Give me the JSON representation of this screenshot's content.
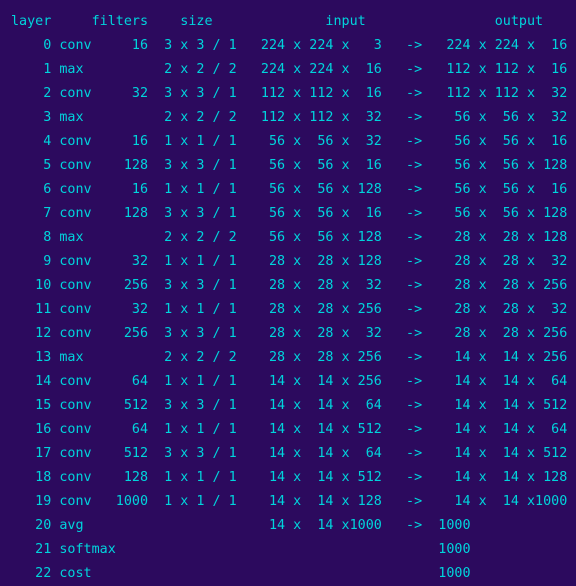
{
  "terminal": {
    "colors": {
      "background": "#2c0a5e",
      "text": "#00d4dc"
    },
    "header": "layer     filters    size              input                output",
    "rows": [
      "    0 conv     16  3 x 3 / 1   224 x 224 x   3   ->   224 x 224 x  16",
      "    1 max          2 x 2 / 2   224 x 224 x  16   ->   112 x 112 x  16",
      "    2 conv     32  3 x 3 / 1   112 x 112 x  16   ->   112 x 112 x  32",
      "    3 max          2 x 2 / 2   112 x 112 x  32   ->    56 x  56 x  32",
      "    4 conv     16  1 x 1 / 1    56 x  56 x  32   ->    56 x  56 x  16",
      "    5 conv    128  3 x 3 / 1    56 x  56 x  16   ->    56 x  56 x 128",
      "    6 conv     16  1 x 1 / 1    56 x  56 x 128   ->    56 x  56 x  16",
      "    7 conv    128  3 x 3 / 1    56 x  56 x  16   ->    56 x  56 x 128",
      "    8 max          2 x 2 / 2    56 x  56 x 128   ->    28 x  28 x 128",
      "    9 conv     32  1 x 1 / 1    28 x  28 x 128   ->    28 x  28 x  32",
      "   10 conv    256  3 x 3 / 1    28 x  28 x  32   ->    28 x  28 x 256",
      "   11 conv     32  1 x 1 / 1    28 x  28 x 256   ->    28 x  28 x  32",
      "   12 conv    256  3 x 3 / 1    28 x  28 x  32   ->    28 x  28 x 256",
      "   13 max          2 x 2 / 2    28 x  28 x 256   ->    14 x  14 x 256",
      "   14 conv     64  1 x 1 / 1    14 x  14 x 256   ->    14 x  14 x  64",
      "   15 conv    512  3 x 3 / 1    14 x  14 x  64   ->    14 x  14 x 512",
      "   16 conv     64  1 x 1 / 1    14 x  14 x 512   ->    14 x  14 x  64",
      "   17 conv    512  3 x 3 / 1    14 x  14 x  64   ->    14 x  14 x 512",
      "   18 conv    128  1 x 1 / 1    14 x  14 x 512   ->    14 x  14 x 128",
      "   19 conv   1000  1 x 1 / 1    14 x  14 x 128   ->    14 x  14 x1000",
      "   20 avg                       14 x  14 x1000   ->  1000",
      "   21 softmax                                        1000",
      "   22 cost                                           1000"
    ]
  }
}
